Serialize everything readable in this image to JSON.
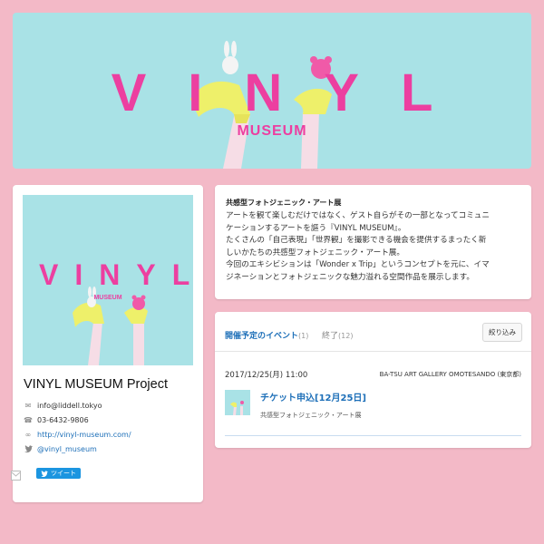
{
  "banner": {
    "logo": "VINYL",
    "subtitle": "MUSEUM"
  },
  "profile": {
    "thumb_logo": "VINYL",
    "thumb_sub": "MUSEUM",
    "name": "VINYL MUSEUM Project",
    "email": "info@liddell.tokyo",
    "phone": "03-6432-9806",
    "website": "http://vinyl-museum.com/",
    "twitter": "@vinyl_museum",
    "tweet_label": "ツイート"
  },
  "about": {
    "heading": "共感型フォトジェニック・アート展",
    "lines": [
      "アートを観て楽しむだけではなく、ゲスト自らがその一部となってコミュニ",
      "ケーションするアートを謳う『VINYL MUSEUM』。",
      "たくさんの「自己表現」「世界観」を撮影できる機会を提供するまったく新",
      "しいかたちの共感型フォトジェニック・アート展。",
      "今回のエキシビションは「Wonder x Trip」というコンセプトを元に、イマ",
      "ジネーションとフォトジェニックな魅力溢れる空間作品を展示します。"
    ]
  },
  "events": {
    "tab_upcoming": "開催予定のイベント",
    "tab_upcoming_count": "(1)",
    "tab_ended": "終了",
    "tab_ended_count": "(12)",
    "filter_label": "絞り込み",
    "items": [
      {
        "date": "2017/12/25(月) 11:00",
        "venue": "BA-TSU ART GALLERY OMOTESANDO (東京都)",
        "title": "チケット申込[12月25日]",
        "description": "共感型フォトジェニック・アート展"
      }
    ]
  },
  "colors": {
    "background": "#f3b9c7",
    "banner": "#a9e2e6",
    "logo_pink": "#ec3fa0",
    "link_blue": "#1d6fb8"
  }
}
